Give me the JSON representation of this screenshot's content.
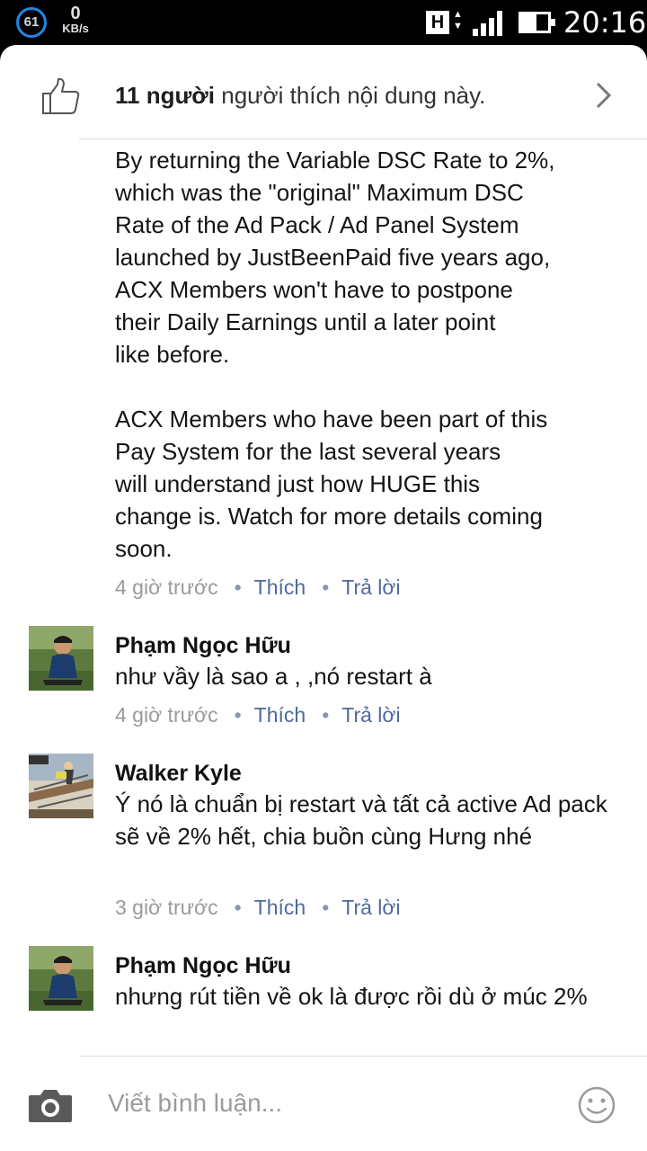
{
  "status_bar": {
    "notification_count": "61",
    "net_speed_value": "0",
    "net_speed_unit": "KB/s",
    "network_type": "H",
    "time": "20:16"
  },
  "likes": {
    "count_label": "11 người",
    "suffix": " người thích nội dung này."
  },
  "post": {
    "paragraph_1": "By returning the Variable DSC Rate to 2%,\nwhich was the \"original\" Maximum DSC\nRate of the Ad Pack / Ad Panel System\nlaunched by JustBeenPaid five years ago,\nACX Members won't  have to postpone\ntheir Daily Earnings until a later point\nlike before.",
    "paragraph_2": "ACX Members who have been part of this\nPay System for the last several years\nwill understand just how HUGE this\nchange is.  Watch for more details coming\nsoon.",
    "time": "4 giờ trước",
    "like_action": "Thích",
    "reply_action": "Trả lời"
  },
  "comments": [
    {
      "author": "Phạm Ngọc Hữu",
      "text": "như vầy là sao a , ,nó restart à",
      "time": "4 giờ trước",
      "like_action": "Thích",
      "reply_action": "Trả lời"
    },
    {
      "author": "Walker Kyle",
      "text": "Ý nó là chuẩn bị restart và tất cả active Ad pack sẽ về 2% hết, chia buồn cùng Hưng nhé",
      "time": "3 giờ trước",
      "like_action": "Thích",
      "reply_action": "Trả lời"
    },
    {
      "author": "Phạm Ngọc Hữu",
      "text": "nhưng rút tiền về ok là được rồi dù ở múc 2%"
    }
  ],
  "composer": {
    "placeholder": "Viết bình luận..."
  },
  "separator": "•",
  "colors": {
    "link": "#4e6a99",
    "meta": "#9a9a9a",
    "status_accent": "#1e88e5"
  }
}
